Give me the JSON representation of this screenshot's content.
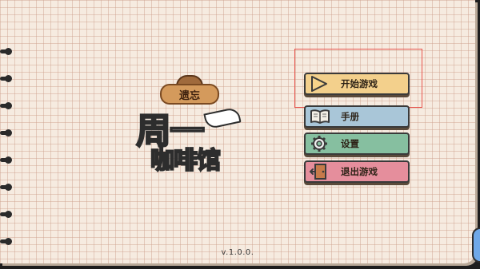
{
  "logo": {
    "top_text": "遗忘",
    "title_main": "周一",
    "title_sub": "咖啡馆"
  },
  "menu": {
    "items": [
      {
        "label": "开始游戏",
        "icon": "play-icon"
      },
      {
        "label": "手册",
        "icon": "book-icon"
      },
      {
        "label": "设置",
        "icon": "gear-icon"
      },
      {
        "label": "退出游戏",
        "icon": "exit-door-icon"
      }
    ]
  },
  "version": "v.1.0.0.",
  "colors": {
    "start_button": "#f3d08c",
    "manual_button": "#a9c6d8",
    "settings_button": "#86bfa0",
    "quit_button": "#e58e9c",
    "highlight_box": "#e8554e"
  }
}
